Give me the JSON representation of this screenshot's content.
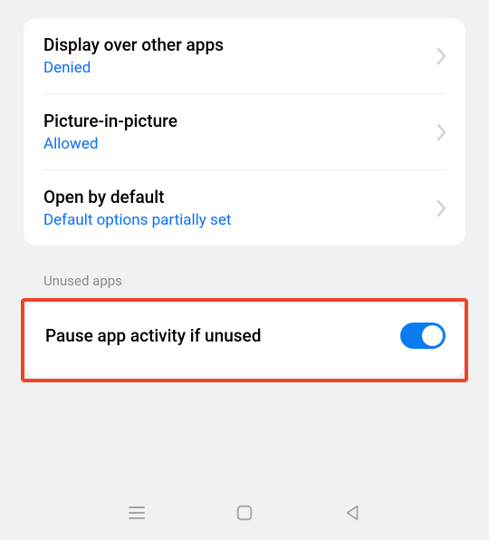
{
  "permissions": [
    {
      "label": "Display over other apps",
      "status": "Denied"
    },
    {
      "label": "Picture-in-picture",
      "status": "Allowed"
    },
    {
      "label": "Open by default",
      "status": "Default options partially set"
    }
  ],
  "sectionHeader": "Unused apps",
  "toggle": {
    "label": "Pause app activity if unused",
    "state": true
  }
}
